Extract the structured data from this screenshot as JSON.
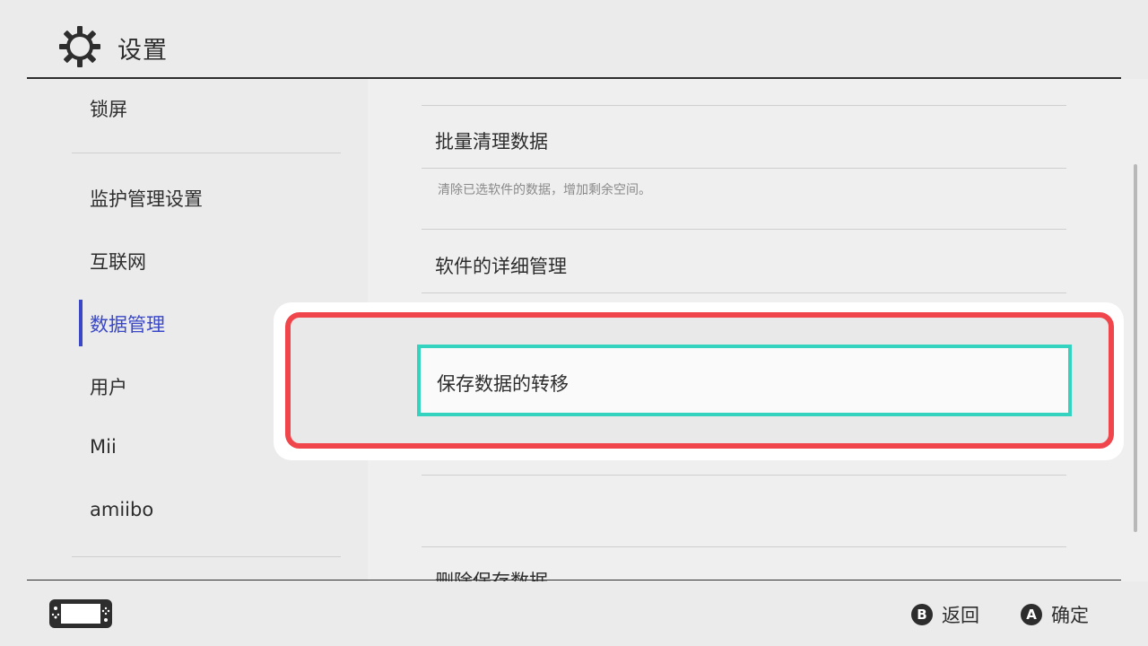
{
  "header": {
    "title": "设置",
    "icon": "gear-icon"
  },
  "sidebar": {
    "items": [
      {
        "label": "锁屏"
      },
      {
        "label": "监护管理设置"
      },
      {
        "label": "互联网"
      },
      {
        "label": "数据管理",
        "active": true
      },
      {
        "label": "用户"
      },
      {
        "label": "Mii"
      },
      {
        "label": "amiibo"
      }
    ]
  },
  "main": {
    "rows": [
      {
        "label": "批量清理数据",
        "description": "清除已选软件的数据，增加剩余空间。"
      },
      {
        "label": "软件的详细管理"
      },
      {
        "label": "保存数据的转移",
        "focused": true
      },
      {
        "label": "删除保存数据"
      }
    ]
  },
  "footer": {
    "console_icon": "console-icon",
    "hints": [
      {
        "button": "B",
        "label": "返回"
      },
      {
        "button": "A",
        "label": "确定"
      }
    ]
  },
  "colors": {
    "accent": "#3a48c8",
    "focus_border": "#34d3c0",
    "highlight_frame": "#f0454a"
  }
}
